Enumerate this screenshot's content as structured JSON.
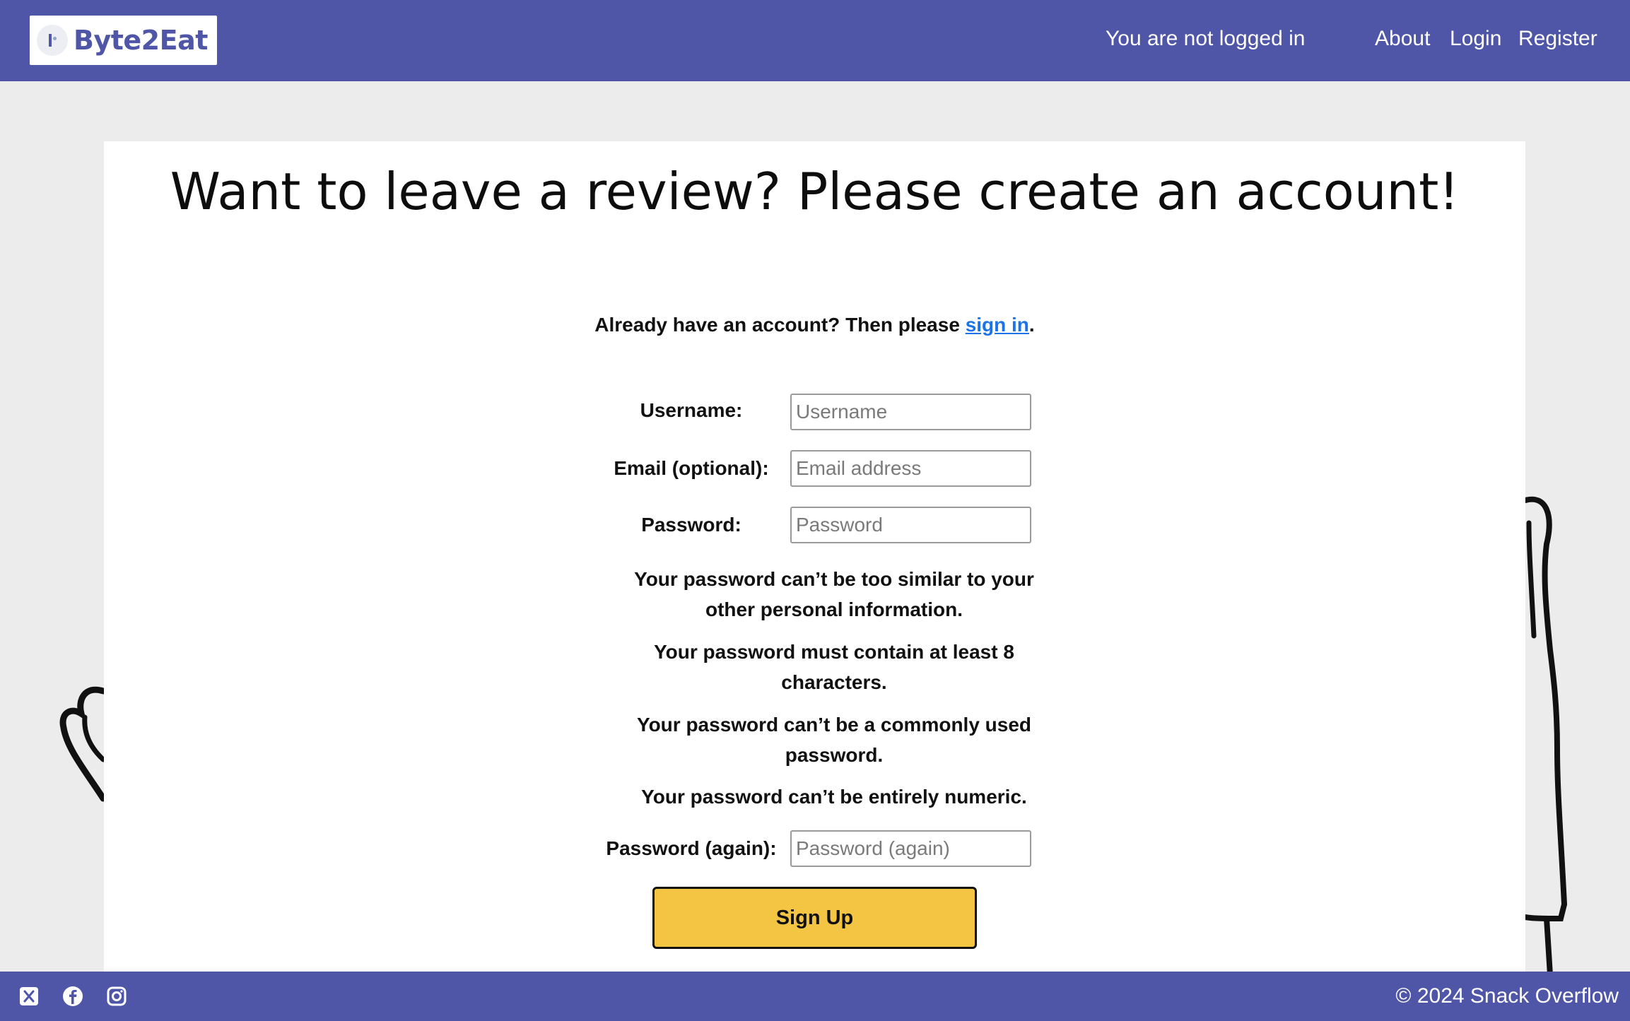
{
  "header": {
    "logo_text": "Byte2Eat",
    "status": "You are not logged in",
    "nav": [
      "About",
      "Login",
      "Register"
    ]
  },
  "main": {
    "title": "Want to leave a review? Please create an account!",
    "already_prefix": "Already have an account? Then please ",
    "already_link": "sign in",
    "already_suffix": ".",
    "fields": {
      "username": {
        "label": "Username:",
        "placeholder": "Username"
      },
      "email": {
        "label": "Email (optional):",
        "placeholder": "Email address"
      },
      "password": {
        "label": "Password:",
        "placeholder": "Password"
      },
      "password2": {
        "label": "Password (again):",
        "placeholder": "Password (again)"
      }
    },
    "help": [
      "Your password can’t be too similar to your other personal information.",
      "Your password must contain at least 8 characters.",
      "Your password can’t be a commonly used password.",
      "Your password can’t be entirely numeric."
    ],
    "submit_label": "Sign Up"
  },
  "footer": {
    "social_icons": [
      "x-icon",
      "facebook-icon",
      "instagram-icon"
    ],
    "copyright": "© 2024 Snack Overflow"
  },
  "colors": {
    "brand": "#4f56a8",
    "background": "#ececec",
    "button": "#f4c542",
    "link": "#1a73e8"
  }
}
